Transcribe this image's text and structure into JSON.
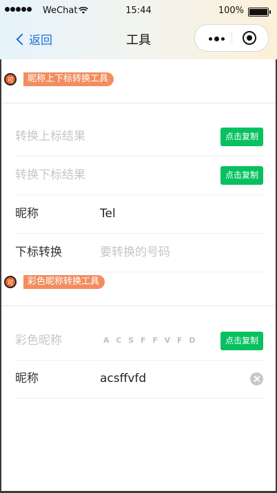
{
  "status_bar": {
    "carrier": "WeChat",
    "time": "15:44",
    "battery_percent": "100%"
  },
  "nav": {
    "back_label": "返回",
    "title": "工具"
  },
  "section_superscript": {
    "badge": "可",
    "title": "昵称上下标转换工具",
    "rows": [
      {
        "label": "转换上标结果",
        "button": "点击复制"
      },
      {
        "label": "转换下标结果",
        "button": "点击复制"
      },
      {
        "label": "昵称",
        "value": "Tel"
      },
      {
        "label": "下标转换",
        "placeholder": "要转换的号码"
      }
    ]
  },
  "section_color": {
    "badge": "可",
    "title": "彩色昵称转换工具",
    "rows": [
      {
        "label": "彩色昵称",
        "value": "A C S F F V F D",
        "button": "点击复制"
      },
      {
        "label": "昵称",
        "value": "acsffvfd"
      }
    ]
  },
  "colors": {
    "accent_green": "#07c160",
    "back_blue": "#1e6fd9",
    "tag_orange": "#f28d60"
  }
}
